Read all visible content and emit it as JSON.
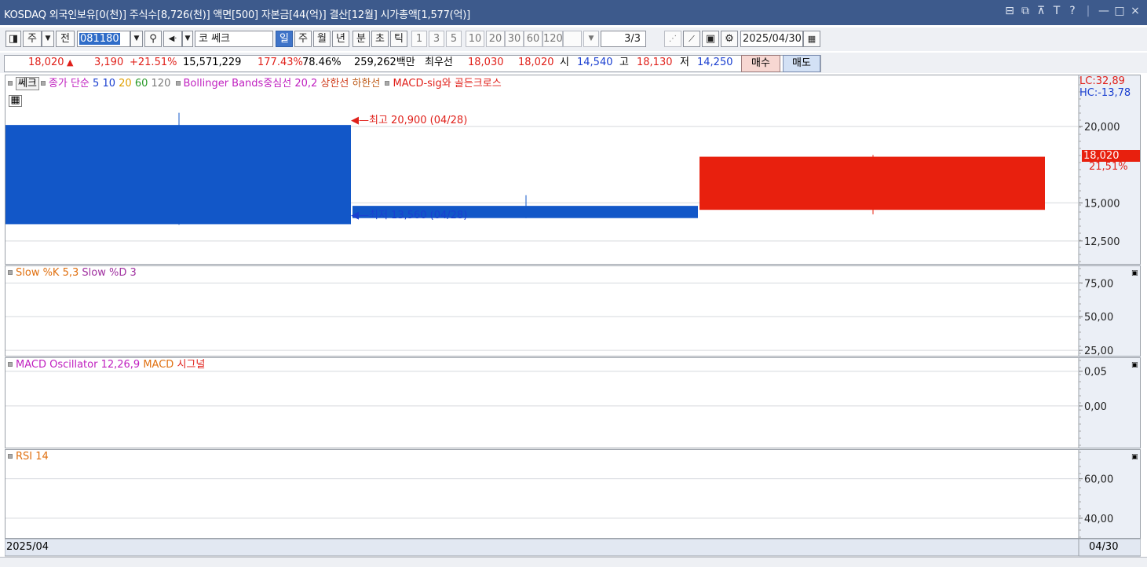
{
  "window": {
    "title": "KOSDAQ 외국인보유[0(천)] 주식수[8,726(천)] 액면[500] 자본금[44(억)] 결산[12월] 시가총액[1,577(억)]",
    "controls": [
      "⊟",
      "⧉",
      "⊼",
      "T",
      "?",
      "|",
      "—",
      "□",
      "×"
    ]
  },
  "toolbar": {
    "btn_chart": "◨",
    "btn_stock": "주",
    "btn_all": "전",
    "code": "081180",
    "stock_name": "코 쎄크",
    "periods": [
      "일",
      "주",
      "월",
      "년",
      "분",
      "초",
      "틱"
    ],
    "active_period": "일",
    "intervals": [
      "1",
      "3",
      "5",
      "10",
      "20",
      "30",
      "60",
      "120"
    ],
    "page": "3/3",
    "date": "2025/04/30"
  },
  "quote": {
    "price": "18,020",
    "direction": "▲",
    "change": "3,190",
    "change_pct": "+21.51%",
    "volume": "15,571,229",
    "volume_ratio": "177.43%",
    "turnover_pct": "78.46%",
    "amount": "259,262백만",
    "best_label": "최우선",
    "best_ask": "18,030",
    "best_bid": "18,020",
    "open_label": "시",
    "open": "14,540",
    "high_label": "고",
    "high": "18,130",
    "low_label": "저",
    "low": "14,250",
    "buy": "매수",
    "sell": "매도"
  },
  "legend": {
    "name_tag": "쎄크",
    "ma_label": "종가 단순",
    "ma_periods": [
      "5",
      "10",
      "20",
      "60",
      "120"
    ],
    "bb_label": "Bollinger Bands중심선 20,2",
    "bb_upper": "상한선",
    "bb_lower": "하한선",
    "macd_sig": "MACD-sig와 골든크로스",
    "slow_k": "Slow %K 5,3",
    "slow_d": "Slow %D 3",
    "macd_osc": "MACD Oscillator 12,26,9",
    "macd": "MACD",
    "signal": "시그널",
    "rsi": "RSI 14"
  },
  "annotations": {
    "lc": "LC:32,89",
    "hc": "HC:-13,78",
    "high_note": "최고 20,900 (04/28)",
    "low_note": "최저 13,560 (04/28)",
    "last_price": "18,020",
    "last_pct": "21,51%"
  },
  "x_axis": {
    "left_label": "2025/04",
    "right_label": "04/30"
  },
  "colors": {
    "up": "#e8200e",
    "down": "#1257c8",
    "title_bg": "#3d5a8c",
    "ma5": "#1a3fd0",
    "ma10": "#1a3fd0",
    "ma20": "#e0a000",
    "ma60": "#2a9a2a",
    "ma120": "#7a7a7a",
    "bb": "#c020c0",
    "bb_upper": "#d04020",
    "bb_lower": "#c06020",
    "slowk": "#e07010",
    "slowd": "#a030a0",
    "macd_osc": "#c020c0",
    "macd": "#e07010",
    "rsi": "#e07010"
  },
  "chart_data": {
    "type": "candlestick",
    "panes": [
      {
        "name": "price",
        "ylim": [
          11000,
          23400
        ],
        "ticks": [
          20000,
          15000,
          12500
        ],
        "tick_labels": [
          "20,000",
          "15,000",
          "12,500"
        ],
        "candles": [
          {
            "open": 20100,
            "high": 20900,
            "low": 13560,
            "close": 13600
          },
          {
            "open": 14800,
            "high": 15500,
            "low": 14000,
            "close": 14000
          },
          {
            "open": 14540,
            "high": 18130,
            "low": 14250,
            "close": 18020
          }
        ]
      },
      {
        "name": "slow_stochastic",
        "ylim": [
          21,
          88
        ],
        "ticks": [
          75,
          50,
          25
        ],
        "tick_labels": [
          "75,00",
          "50,00",
          "25,00"
        ]
      },
      {
        "name": "macd_oscillator",
        "ylim": [
          -0.06,
          0.07
        ],
        "ticks": [
          0.05,
          0
        ],
        "tick_labels": [
          "0,05",
          "0,00"
        ]
      },
      {
        "name": "rsi",
        "ylim": [
          30,
          75
        ],
        "ticks": [
          60,
          40
        ],
        "tick_labels": [
          "60,00",
          "40,00"
        ]
      }
    ]
  }
}
